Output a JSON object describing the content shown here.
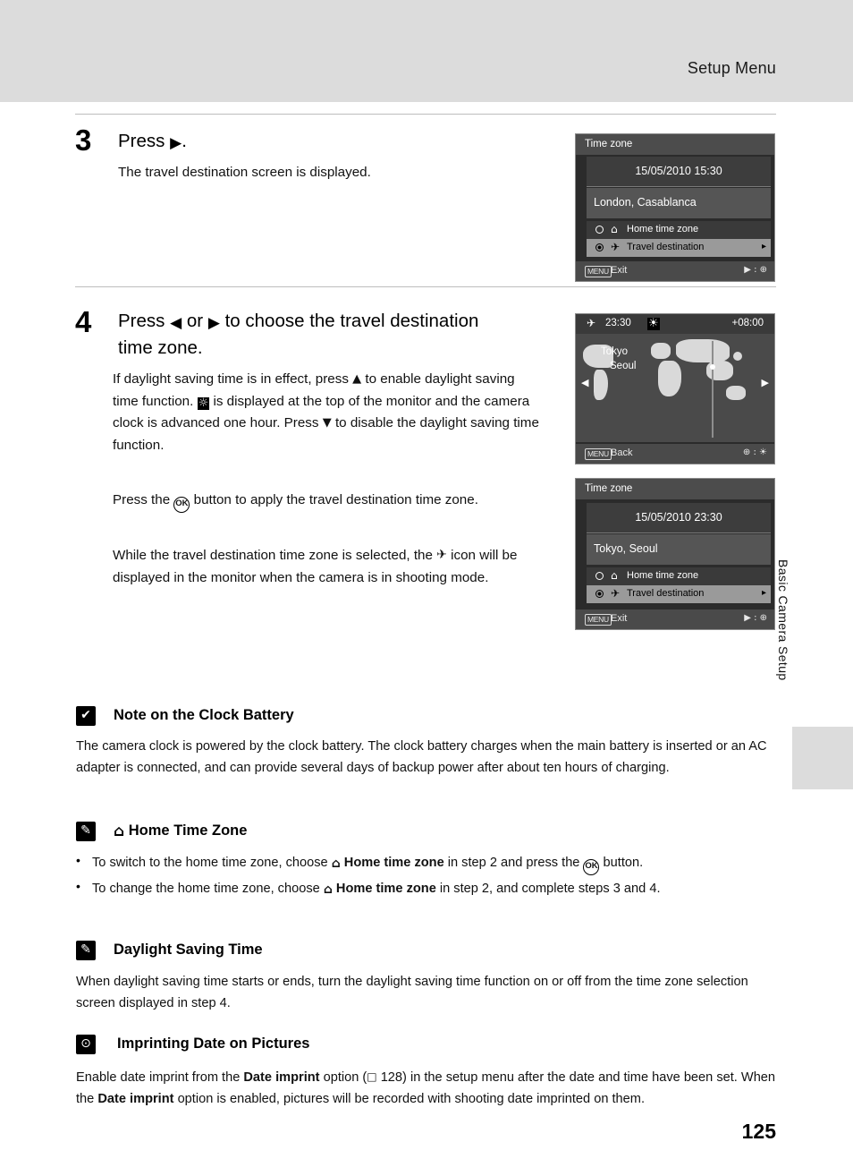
{
  "header": {
    "title": "Setup Menu"
  },
  "side_tab": {
    "label": "Basic Camera Setup"
  },
  "page_number": "125",
  "steps": [
    {
      "number": "3",
      "title_prefix": "Press",
      "title_symbol": "▶",
      "title_suffix": ".",
      "body": "The travel destination screen is displayed."
    },
    {
      "number": "4",
      "title_line1_a": "Press",
      "title_sym_left": "◀",
      "title_line1_b": "or",
      "title_sym_right": "▶",
      "title_line1_c": "to choose the travel destination",
      "title_line2": "time zone.",
      "paragraph1_a": "If daylight saving time is in effect, press",
      "paragraph1_sym": "▲",
      "paragraph1_b": "to enable daylight saving time function.",
      "paragraph1_c": "is displayed at the top of the monitor and the camera clock is advanced one hour. Press",
      "paragraph1_sym2": "▼",
      "paragraph1_d": "to disable the daylight saving time function.",
      "paragraph2_a": "Press the",
      "paragraph2_ok": "OK",
      "paragraph2_b": "button to apply the travel destination time zone.",
      "paragraph3_a": "While the travel destination time zone is selected, the",
      "paragraph3_b": "icon will be displayed in the monitor when the camera is in shooting mode."
    }
  ],
  "lcd_screens": [
    {
      "id": "travel-destination-screen-1",
      "title": "Time zone",
      "date": "15/05/2010 15:30",
      "city": "London, Casablanca",
      "rows": [
        {
          "icon": "⌂",
          "label": "Home time zone",
          "selected": false,
          "highlight": false,
          "arrow": ""
        },
        {
          "icon": "✈",
          "label": "Travel destination",
          "selected": true,
          "highlight": true,
          "arrow": "▸"
        }
      ],
      "bottom_left_chip": "MENU",
      "bottom_left_label": "Exit",
      "bottom_right": "▶ : ⊕"
    },
    {
      "id": "world-map-screen",
      "top_left_icon": "✈",
      "top_time": "23:30",
      "top_dst_icon": "☀",
      "top_offset": "+08:00",
      "city_line1": "Tokyo",
      "city_line2": "Seoul",
      "left_arrow": "◀",
      "right_arrow": "▶",
      "bottom_left_chip": "MENU",
      "bottom_left_label": "Back",
      "bottom_right": "⊕ : ☀"
    },
    {
      "id": "travel-destination-screen-2",
      "title": "Time zone",
      "date": "15/05/2010 23:30",
      "city": "Tokyo, Seoul",
      "rows": [
        {
          "icon": "⌂",
          "label": "Home time zone",
          "selected": false,
          "highlight": false,
          "arrow": ""
        },
        {
          "icon": "✈",
          "label": "Travel destination",
          "selected": true,
          "highlight": true,
          "arrow": "▸"
        }
      ],
      "bottom_left_chip": "MENU",
      "bottom_left_label": "Exit",
      "bottom_right": "▶ : ⊕"
    }
  ],
  "notes": [
    {
      "id": "clock-battery",
      "icon": "✔",
      "heading": "Note on the Clock Battery",
      "body": "The camera clock is powered by the clock battery. The clock battery charges when the main battery is inserted or an AC adapter is connected, and can provide several days of backup power after about ten hours of charging."
    },
    {
      "id": "home-time-zone",
      "icon": "✎",
      "heading_icon": "⌂",
      "heading": "Home Time Zone",
      "bullets": [
        {
          "a": "To switch to the home time zone, choose",
          "bold_icon": "⌂",
          "bold": "Home time zone",
          "b": "in step 2 and press the",
          "ok": "OK",
          "c": "button."
        },
        {
          "a": "To change the home time zone, choose",
          "bold_icon": "⌂",
          "bold": "Home time zone",
          "b": "in step 2, and complete steps 3 and 4."
        }
      ]
    },
    {
      "id": "daylight-saving-time",
      "icon": "✎",
      "heading": "Daylight Saving Time",
      "body": "When daylight saving time starts or ends, turn the daylight saving time function on or off from the time zone selection screen displayed in step 4."
    },
    {
      "id": "imprinting-date",
      "icon": "⊙",
      "heading": "Imprinting Date on Pictures",
      "body_a": "Enable date imprint from the",
      "body_bold1": "Date imprint",
      "body_b": "option (",
      "body_ref_icon": "□",
      "body_ref": "128",
      "body_c": ") in the setup menu after the date and time have been set. When the",
      "body_bold2": "Date imprint",
      "body_d": "option is enabled, pictures will be recorded with shooting date imprinted on them."
    }
  ]
}
